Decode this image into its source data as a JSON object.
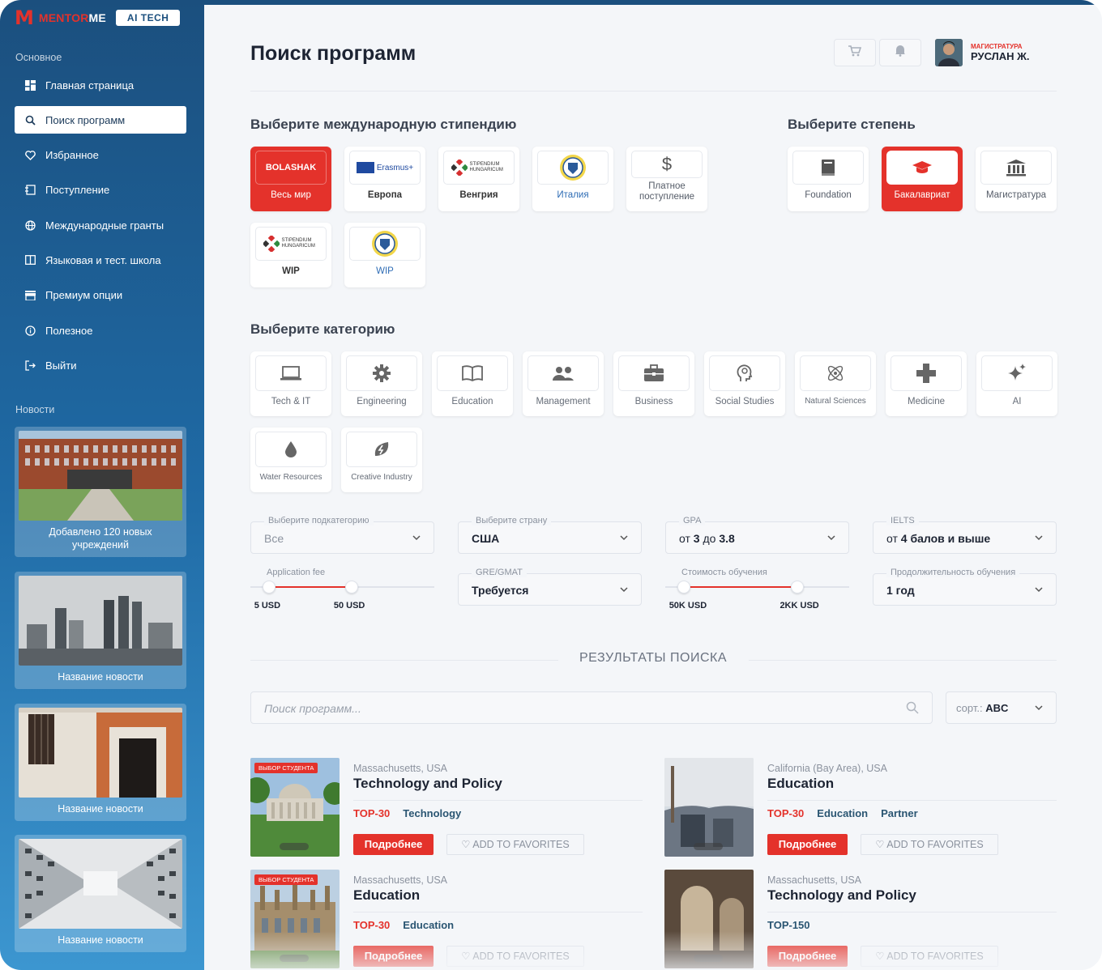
{
  "brand": {
    "logo_part1": "MENTOR",
    "logo_part2": "ME",
    "badge": "AI TECH"
  },
  "sidebar": {
    "section_main": "Основное",
    "items": [
      {
        "label": "Главная страница",
        "icon": "dashboard-icon"
      },
      {
        "label": "Поиск программ",
        "icon": "search-icon"
      },
      {
        "label": "Избранное",
        "icon": "heart-icon"
      },
      {
        "label": "Поступление",
        "icon": "admission-icon"
      },
      {
        "label": "Международные гранты",
        "icon": "globe-icon"
      },
      {
        "label": "Языковая и тест. школа",
        "icon": "book-icon"
      },
      {
        "label": "Премиум опции",
        "icon": "store-icon"
      },
      {
        "label": "Полезное",
        "icon": "info-icon"
      },
      {
        "label": "Выйти",
        "icon": "logout-icon"
      }
    ],
    "section_news": "Новости",
    "news": [
      {
        "caption": "Добавлено 120 новых учреждений"
      },
      {
        "caption": "Название новости"
      },
      {
        "caption": "Название новости"
      },
      {
        "caption": "Название новости"
      }
    ]
  },
  "header": {
    "title": "Поиск программ",
    "user_role": "МАГИСТРАТУРА",
    "user_name": "РУСЛАН Ж."
  },
  "scholarships": {
    "title": "Выберите международную стипендию",
    "items": [
      {
        "label": "Весь мир",
        "logo": "BOLASHAK",
        "selected": true
      },
      {
        "label": "Европа",
        "logo": "Erasmus+"
      },
      {
        "label": "Венгрия",
        "logo": "STIPENDIUM HUNGARICUM"
      },
      {
        "label": "Италия",
        "logo": "italy-seal"
      },
      {
        "label": "Платное поступление",
        "logo": "$"
      },
      {
        "label": "WIP",
        "logo": "STIPENDIUM HUNGARICUM"
      },
      {
        "label": "WIP",
        "logo": "italy-seal"
      }
    ]
  },
  "degrees": {
    "title": "Выберите степень",
    "items": [
      {
        "label": "Foundation",
        "icon": "book-icon"
      },
      {
        "label": "Бакалавриат",
        "icon": "graduation-cap-icon",
        "selected": true
      },
      {
        "label": "Магистратура",
        "icon": "institution-icon"
      }
    ]
  },
  "categories": {
    "title": "Выберите категорию",
    "items": [
      {
        "label": "Tech & IT",
        "icon": "laptop-icon"
      },
      {
        "label": "Engineering",
        "icon": "gear-icon"
      },
      {
        "label": "Education",
        "icon": "open-book-icon"
      },
      {
        "label": "Management",
        "icon": "people-icon"
      },
      {
        "label": "Business",
        "icon": "briefcase-icon"
      },
      {
        "label": "Social Studies",
        "icon": "head-icon"
      },
      {
        "label": "Natural Sciences",
        "icon": "atom-icon"
      },
      {
        "label": "Medicine",
        "icon": "cross-icon"
      },
      {
        "label": "AI",
        "icon": "sparkle-icon"
      },
      {
        "label": "Water Resources",
        "icon": "drop-icon"
      },
      {
        "label": "Creative Industry",
        "icon": "leaf-icon"
      }
    ]
  },
  "filters": {
    "subcategory": {
      "legend": "Выберите подкатегорию",
      "value": "Все"
    },
    "country": {
      "legend": "Выберите страну",
      "value": "США"
    },
    "gpa": {
      "legend": "GPA",
      "prefix": "от",
      "from": "3",
      "mid": "до",
      "to": "3.8"
    },
    "ielts": {
      "legend": "IELTS",
      "prefix": "от",
      "value": "4 балов и выше"
    },
    "app_fee": {
      "legend": "Application fee",
      "min_label": "5 USD",
      "max_label": "50 USD",
      "low": 0.1,
      "high": 0.55
    },
    "gre": {
      "legend": "GRE/GMAT",
      "value": "Требуется"
    },
    "tuition": {
      "legend": "Стоимость обучения",
      "min_label": "50K USD",
      "max_label": "2KK USD",
      "low": 0.1,
      "high": 0.72
    },
    "duration": {
      "legend": "Продолжительность обучения",
      "value": "1 год"
    }
  },
  "results": {
    "title": "РЕЗУЛЬТАТЫ ПОИСКА",
    "search_placeholder": "Поиск программ...",
    "sort_label": "сорт.:",
    "sort_value": "ABC",
    "more_label": "Подробнее",
    "fav_label": "ADD TO FAVORITES",
    "badge_label": "ВЫБОР СТУДЕНТА",
    "cards": [
      {
        "location": "Massachusetts, USA",
        "title": "Technology and Policy",
        "tags": [
          "TOP-30",
          "Technology"
        ]
      },
      {
        "location": "California (Bay Area), USA",
        "title": "Education",
        "tags": [
          "TOP-30",
          "Education",
          "Partner"
        ]
      },
      {
        "location": "Massachusetts, USA",
        "title": "Education",
        "tags": [
          "TOP-30",
          "Education"
        ]
      },
      {
        "location": "Massachusetts, USA",
        "title": "Technology and Policy",
        "tags": [
          "TOP-150"
        ]
      }
    ]
  },
  "colors": {
    "accent": "#e4322b",
    "sidebar": "#1f6aa5",
    "dark_blue": "#2a5572"
  }
}
